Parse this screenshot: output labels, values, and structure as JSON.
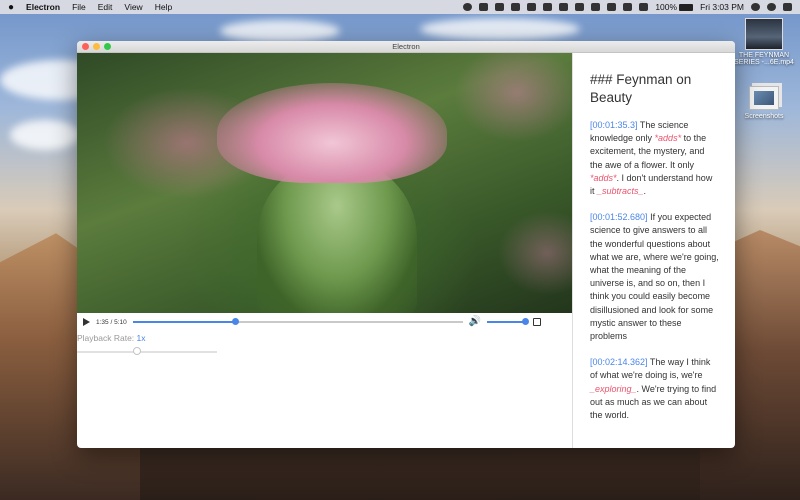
{
  "menubar": {
    "app_name": "Electron",
    "items": [
      "File",
      "Edit",
      "View",
      "Help"
    ],
    "battery": "100%",
    "clock": "Fri 3:03 PM"
  },
  "desktop": {
    "video_file_label": "THE FEYNMAN SERIES -...6E.mp4",
    "screenshots_label": "Screenshots"
  },
  "window": {
    "title": "Electron"
  },
  "player": {
    "time": "1:35 / 5:10",
    "progress_fraction": 0.31,
    "volume_fraction": 0.95,
    "rate_label": "Playback Rate: ",
    "rate_value": "1x",
    "rate_slider_fraction": 0.43
  },
  "notes": {
    "heading": "### Feynman on Beauty",
    "paragraphs": [
      [
        {
          "t": "[00:01:35.3]",
          "s": "ts"
        },
        {
          "t": " The science knowledge only ",
          "s": ""
        },
        {
          "t": "*adds*",
          "s": "em"
        },
        {
          "t": " to the excitement, the mystery, and the awe of a flower. It only ",
          "s": ""
        },
        {
          "t": "*adds*",
          "s": "em"
        },
        {
          "t": ". I don't understand how it ",
          "s": ""
        },
        {
          "t": "_subtracts_",
          "s": "em"
        },
        {
          "t": ".",
          "s": ""
        }
      ],
      [
        {
          "t": "[00:01:52.680]",
          "s": "ts"
        },
        {
          "t": " If you expected science to give answers to all the wonderful questions about what we are, where we're going, what the meaning of the universe is, and so on, then I think you could easily become disillusioned and look for some mystic answer to these problems",
          "s": ""
        }
      ],
      [
        {
          "t": "[00:02:14.362]",
          "s": "ts"
        },
        {
          "t": " The way I think of what we're doing is, we're ",
          "s": ""
        },
        {
          "t": "_exploring_",
          "s": "em"
        },
        {
          "t": ". We're trying to find out as much as we can about the world.",
          "s": ""
        }
      ]
    ]
  }
}
